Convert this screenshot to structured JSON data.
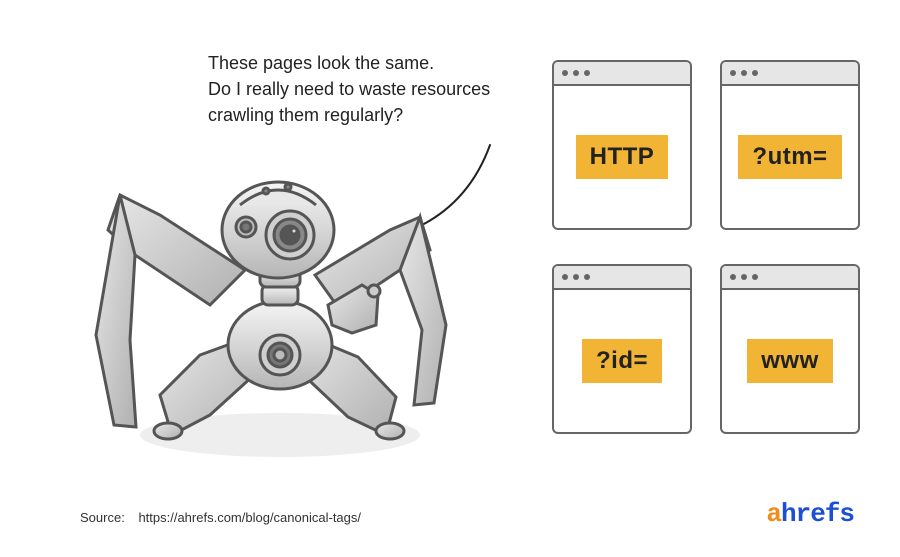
{
  "speech": {
    "line1": "These pages look the same.",
    "line2": "Do I really need to waste resources",
    "line3": "crawling them regularly?"
  },
  "windows": [
    {
      "label": "HTTP"
    },
    {
      "label": "?utm="
    },
    {
      "label": "?id="
    },
    {
      "label": "www"
    }
  ],
  "source": {
    "label": "Source:",
    "url_text": "https://ahrefs.com/blog/canonical-tags/"
  },
  "logo": {
    "accent": "a",
    "rest": "hrefs"
  },
  "colors": {
    "badge_bg": "#f1b434",
    "logo_blue": "#1a4fd6",
    "logo_orange": "#f28c1b"
  }
}
